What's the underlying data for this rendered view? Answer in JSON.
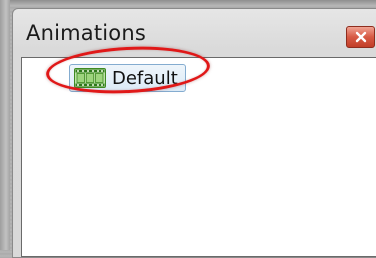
{
  "panel": {
    "title": "Animations",
    "close_icon": "close-icon",
    "accent_close_color": "#d75a44"
  },
  "list": {
    "items": [
      {
        "label": "Default",
        "icon": "film-icon",
        "selected": true
      }
    ]
  },
  "annotation": {
    "shape": "ellipse",
    "color": "#e01818",
    "target": "list-item-default"
  }
}
